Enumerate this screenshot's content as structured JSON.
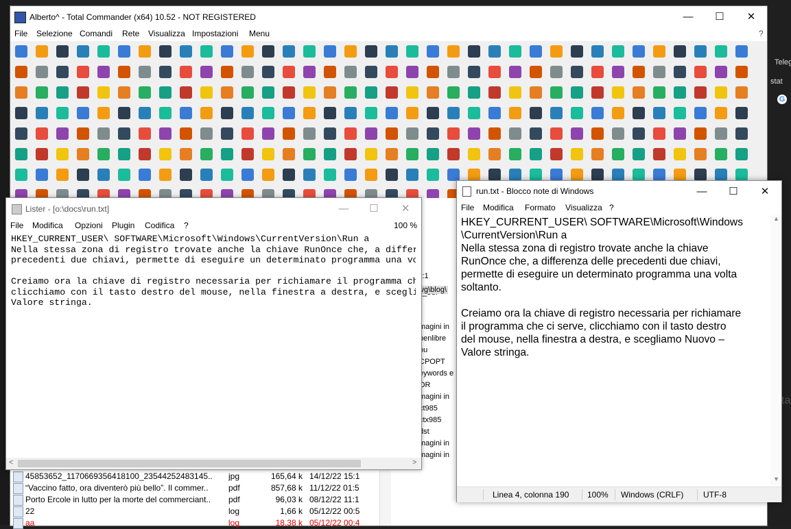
{
  "desktop": {
    "right_labels": [
      "Teleg",
      "stat"
    ],
    "right_partial": "ta"
  },
  "tc": {
    "title": "Alberto^ - Total Commander (x64) 10.52 - NOT REGISTERED",
    "menu": [
      "File",
      "Selezione",
      "Comandi",
      "Rete",
      "Visualizza",
      "Impostazioni",
      "Menu"
    ],
    "help": "?",
    "buttons": {
      "minimize": "—",
      "maximize": "☐",
      "close": "✕"
    },
    "mid_panel": {
      "zoom_label": "j:1",
      "search_label": "L_ser",
      "path_fragment": "svg\\blog\\",
      "items": [
        "]",
        "magini in",
        "penlibre",
        "ou",
        "CPOPT",
        "eywords e",
        "OR",
        "magini in",
        "ct985",
        "ctx985",
        "dst",
        "magini in",
        "magini in"
      ]
    },
    "files": [
      {
        "name": "45853652_1170669356418100_23544252483145..",
        "ext": "jpg",
        "size": "165,64 k",
        "date": "14/12/22 15:1",
        "red": false
      },
      {
        "name": "“Vaccino fatto, ora diventerò più bello”. Il commer..",
        "ext": "pdf",
        "size": "857,68 k",
        "date": "11/12/22 01:5",
        "red": false
      },
      {
        "name": "Porto Ercole in lutto per la morte del commerciant..",
        "ext": "pdf",
        "size": "96,03 k",
        "date": "08/12/22 11:1",
        "red": false
      },
      {
        "name": "22",
        "ext": "log",
        "size": "1,66 k",
        "date": "05/12/22 00:5",
        "red": false
      },
      {
        "name": "aa",
        "ext": "log",
        "size": "18,38 k",
        "date": "05/12/22 00:4",
        "red": true
      }
    ]
  },
  "lister": {
    "title": "Lister - [o:\\docs\\run.txt]",
    "menu": [
      "File",
      "Modifica",
      "Opzioni",
      "Plugin",
      "Codifica",
      "?"
    ],
    "zoom": "100 %",
    "buttons": {
      "minimize": "—",
      "maximize": "☐",
      "close": "✕"
    },
    "text": "HKEY_CURRENT_USER\\ SOFTWARE\\Microsoft\\Windows\\CurrentVersion\\Run a\nNella stessa zona di registro trovate anche la chiave RunOnce che, a differ\nprecedenti due chiavi, permette di eseguire un determinato programma una vo\n\nCreiamo ora la chiave di registro necessaria per richiamare il programma ch\nclicchiamo con il tasto destro del mouse, nella finestra a destra, e scegli\nValore stringa."
  },
  "notepad": {
    "title": "run.txt - Blocco note di Windows",
    "menu": [
      "File",
      "Modifica",
      "Formato",
      "Visualizza",
      "?"
    ],
    "buttons": {
      "minimize": "—",
      "maximize": "☐",
      "close": "✕"
    },
    "text": "HKEY_CURRENT_USER\\ SOFTWARE\\Microsoft\\Windows\n\\CurrentVersion\\Run a\nNella stessa zona di registro trovate anche la chiave\nRunOnce che, a differenza delle precedenti due chiavi,\npermette di eseguire un determinato programma una volta\nsoltanto.\n\nCreiamo ora la chiave di registro necessaria per richiamare\nil programma che ci serve, clicchiamo con il tasto destro\ndel mouse, nella finestra a destra, e scegliamo Nuovo –\nValore stringa.",
    "status": {
      "position": "Linea 4, colonna 190",
      "zoom": "100%",
      "line_ending": "Windows (CRLF)",
      "encoding": "UTF-8"
    }
  }
}
